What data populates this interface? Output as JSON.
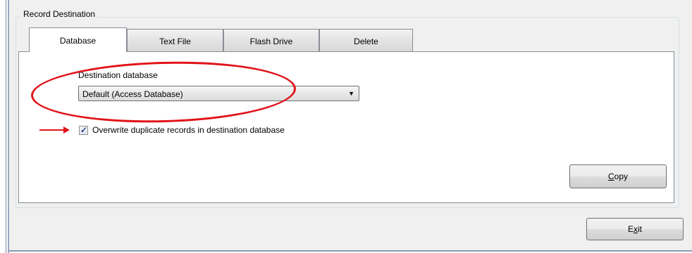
{
  "group": {
    "title": "Record Destination"
  },
  "tabs": [
    {
      "label": "Database",
      "active": true
    },
    {
      "label": "Text File",
      "active": false
    },
    {
      "label": "Flash Drive",
      "active": false
    },
    {
      "label": "Delete",
      "active": false
    }
  ],
  "database_tab": {
    "destination_label": "Destination database",
    "destination_value": "Default (Access Database)",
    "overwrite_label": "Overwrite duplicate records in destination database",
    "overwrite_checked": true
  },
  "buttons": {
    "copy_mnemonic": "C",
    "copy_rest": "opy",
    "exit_first": "E",
    "exit_mnemonic": "x",
    "exit_rest": "it"
  },
  "annotation_color": "#e0141a"
}
